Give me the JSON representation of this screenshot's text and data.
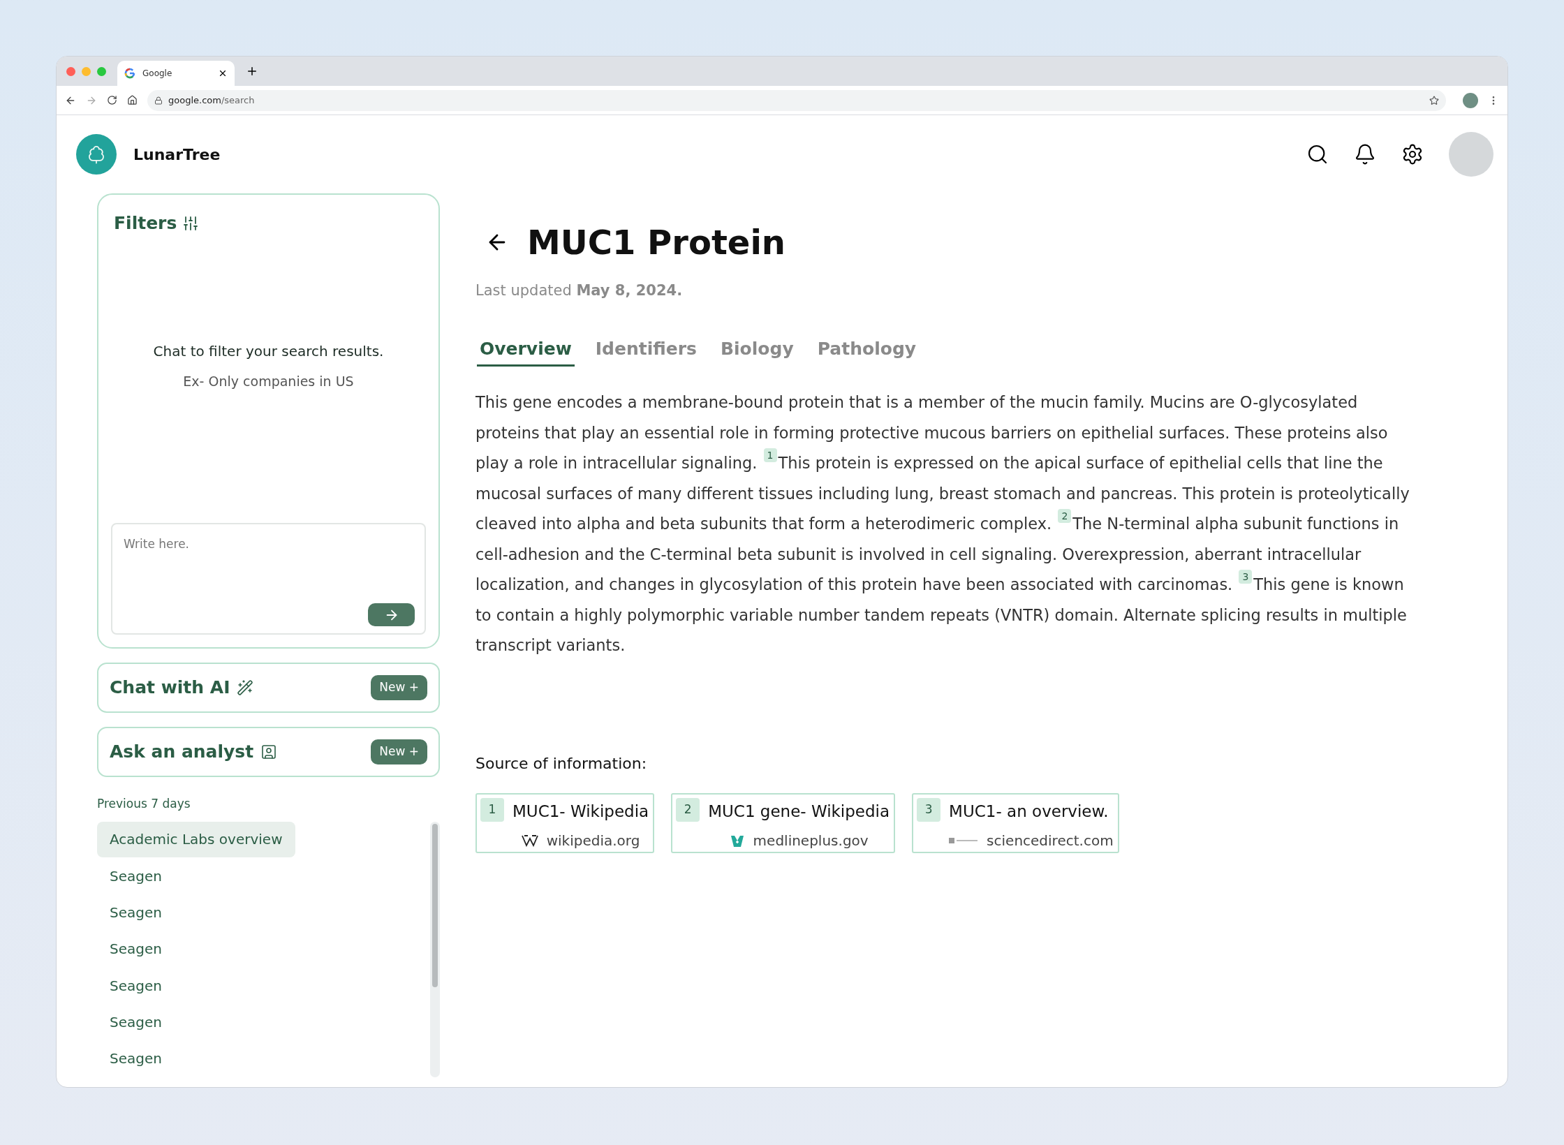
{
  "browser": {
    "tab_title": "Google",
    "url_host": "google.com",
    "url_path": "/search"
  },
  "app": {
    "brand": "LunarTree"
  },
  "filters": {
    "title": "Filters",
    "prompt": "Chat to filter your search results.",
    "example": "Ex- Only companies in US",
    "input_placeholder": "Write here."
  },
  "sidebar_actions": [
    {
      "kind": "chat",
      "label": "Chat with AI",
      "button": "New +"
    },
    {
      "kind": "analyst",
      "label": "Ask an analyst",
      "button": "New +"
    }
  ],
  "history": {
    "heading": "Previous 7 days",
    "items": [
      {
        "label": "Academic Labs overview",
        "selected": true
      },
      {
        "label": "Seagen",
        "selected": false
      },
      {
        "label": "Seagen",
        "selected": false
      },
      {
        "label": "Seagen",
        "selected": false
      },
      {
        "label": "Seagen",
        "selected": false
      },
      {
        "label": "Seagen",
        "selected": false
      },
      {
        "label": "Seagen",
        "selected": false
      }
    ]
  },
  "article": {
    "title": "MUC1 Protein",
    "updated": "Last updated **May 8, 2024.**"
  },
  "tabs": [
    {
      "label": "Overview",
      "selected": true
    },
    {
      "label": "Identifiers",
      "selected": false
    },
    {
      "label": "Biology",
      "selected": false
    },
    {
      "label": "Pathology",
      "selected": false
    }
  ],
  "paragraph": [
    {
      "kind": "text",
      "text": "This gene encodes a membrane-bound protein that is a member of the mucin family. Mucins are O-glycosylated proteins that play an essential role in forming protective mucous barriers on epithelial surfaces. These proteins also play a role in intracellular signaling."
    },
    {
      "kind": "citation",
      "text": "1"
    },
    {
      "kind": "text",
      "text": "This protein is expressed on the apical surface of epithelial cells that line the mucosal surfaces of many different tissues including lung, breast stomach and pancreas. This protein is proteolytically cleaved into alpha and beta subunits that form a heterodimeric complex."
    },
    {
      "kind": "citation",
      "text": "2"
    },
    {
      "kind": "text",
      "text": "The N-terminal alpha subunit functions in cell-adhesion and the C-terminal beta subunit is involved in cell signaling. Overexpression, aberrant intracellular localization, and changes in glycosylation of this protein have been associated with carcinomas."
    },
    {
      "kind": "citation",
      "text": "3"
    },
    {
      "kind": "text",
      "text": "This gene is known to contain a highly polymorphic variable number tandem repeats (VNTR) domain. Alternate splicing results in multiple transcript variants."
    }
  ],
  "sources": {
    "heading": "Source of information:",
    "items": [
      {
        "kind": "wikipedia",
        "number": "1",
        "title": "MUC1- Wikipedia",
        "domain": "wikipedia.org"
      },
      {
        "kind": "medline",
        "number": "2",
        "title": "MUC1 gene- Wikipedia",
        "domain": "medlineplus.gov"
      },
      {
        "kind": "sciencedirect",
        "number": "3",
        "title": "MUC1- an overview.",
        "domain": "sciencedirect.com"
      }
    ]
  }
}
